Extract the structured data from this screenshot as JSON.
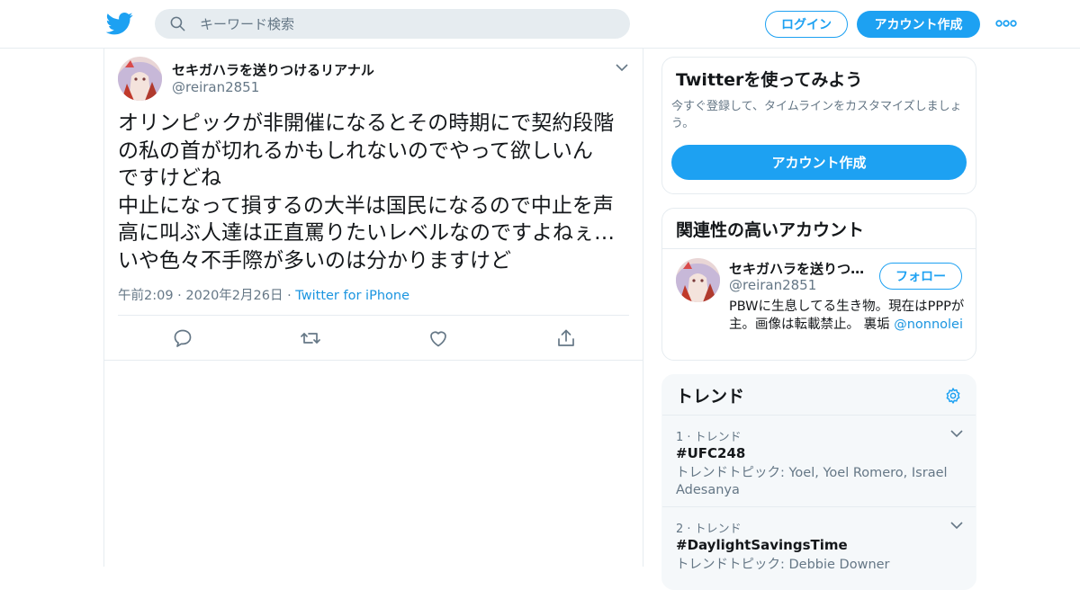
{
  "header": {
    "search_placeholder": "キーワード検索",
    "login_label": "ログイン",
    "signup_label": "アカウント作成"
  },
  "tweet": {
    "author_name": "セキガハラを送りつけるリアナル",
    "author_handle": "@reiran2851",
    "text": "オリンピックが非開催になるとその時期にで契約段階\nの私の首が切れるかもしれないのでやって欲しいん\nですけどね\n中止になって損するの大半は国民になるので中止を声\n高に叫ぶ人達は正直罵りたいレベルなのですよねぇ…\nいや色々不手際が多いのは分かりますけど",
    "timestamp": "午前2:09 · 2020年2月26日",
    "separator": " · ",
    "source": "Twitter for iPhone"
  },
  "signup_card": {
    "title": "Twitterを使ってみよう",
    "description": "今すぐ登録して、タイムラインをカスタマイズしましょう。",
    "button_label": "アカウント作成"
  },
  "related": {
    "title": "関連性の高いアカウント",
    "name": "セキガハラを送りつけるリアナル",
    "handle": "@reiran2851",
    "follow_label": "フォロー",
    "bio": "PBWに生息してる生き物。現在はPPPが主。画像は転載禁止。 裏垢 ",
    "bio_mention": "@nonnolei"
  },
  "trends": {
    "title": "トレンド",
    "items": [
      {
        "rank": "1 · トレンド",
        "name": "#UFC248",
        "topic": "トレンドトピック: Yoel, Yoel Romero, Israel Adesanya"
      },
      {
        "rank": "2 · トレンド",
        "name": "#DaylightSavingsTime",
        "topic": "トレンドトピック: Debbie Downer"
      }
    ]
  },
  "colors": {
    "accent": "#1da1f2",
    "link": "#1b95e0",
    "muted": "#657786",
    "border": "#e6ecf0"
  },
  "icons": [
    "twitter-bird-icon",
    "search-icon",
    "more-dots-icon",
    "chevron-down-icon",
    "reply-icon",
    "retweet-icon",
    "like-icon",
    "share-icon",
    "settings-gear-icon"
  ]
}
